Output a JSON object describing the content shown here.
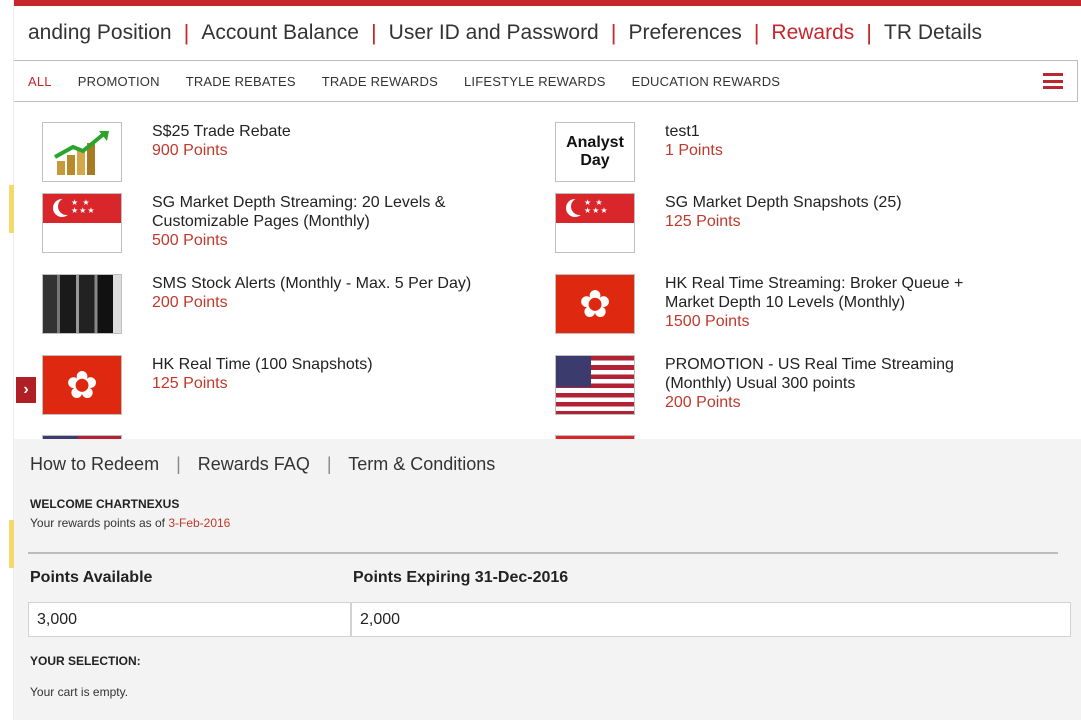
{
  "top_nav": {
    "items": [
      "anding Position",
      "Account Balance",
      "User ID and Password",
      "Preferences",
      "Rewards",
      "TR Details"
    ],
    "active": "Rewards",
    "accent_color": "#c8262d"
  },
  "tabs": [
    "ALL",
    "PROMOTION",
    "TRADE REBATES",
    "TRADE REWARDS",
    "LIFESTYLE REWARDS",
    "EDUCATION REWARDS"
  ],
  "menu_icon": "hamburger-icon",
  "rewards": [
    {
      "title": "S$25 Trade Rebate",
      "points": "900 Points",
      "icon": "chart-coins-icon"
    },
    {
      "title": "test1",
      "points": "1 Points",
      "icon": "analyst-day-icon",
      "icon_text": [
        "Analyst",
        "Day"
      ]
    },
    {
      "title": "SG Market Depth Streaming: 20 Levels & Customizable Pages (Monthly)",
      "points": "500 Points",
      "icon": "sg-flag-icon"
    },
    {
      "title": "SG Market Depth Snapshots (25)",
      "points": "125 Points",
      "icon": "sg-flag-icon"
    },
    {
      "title": "SMS Stock Alerts (Monthly - Max. 5 Per Day)",
      "points": "200 Points",
      "icon": "phones-icon"
    },
    {
      "title": "HK Real Time Streaming: Broker Queue + Market Depth 10 Levels (Monthly)",
      "points": "1500 Points",
      "icon": "hk-flag-icon"
    },
    {
      "title": "HK Real Time (100 Snapshots)",
      "points": "125 Points",
      "icon": "hk-flag-icon"
    },
    {
      "title": "PROMOTION - US Real Time Streaming (Monthly) Usual 300 points",
      "points": "200 Points",
      "icon": "us-flag-icon"
    }
  ],
  "links": [
    "How to Redeem",
    "Rewards FAQ",
    "Term & Conditions"
  ],
  "welcome": "WELCOME CHARTNEXUS",
  "as_of_prefix": "Your rewards points as of ",
  "as_of_date": "3-Feb-2016",
  "points_available_label": "Points Available",
  "points_available": "3,000",
  "points_expiring_label": "Points Expiring 31-Dec-2016",
  "points_expiring": "2,000",
  "selection_label": "YOUR SELECTION:",
  "cart_status": "Your cart is empty.",
  "expand_arrow": "›"
}
